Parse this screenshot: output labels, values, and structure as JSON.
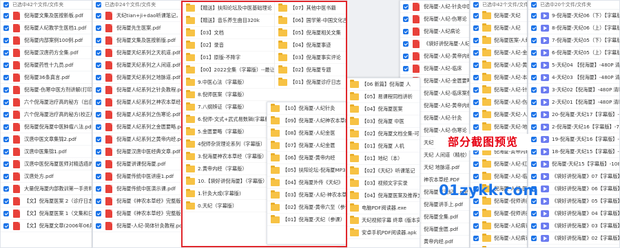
{
  "panel_a": {
    "header": "已选中42个文件/文件夹",
    "items": [
      "倪海厦文集及医按新板.pdf",
      "倪海厦人纪教学生医档1.pdf",
      "倪海厦内部案例100例.pdf",
      "倪海厦汉唐药方全集.pdf",
      "倪海厦药性十九员.pdf",
      "倪海厦36条真言.pdf",
      "倪海厦-伤寒中医方剂讲解(打印版).pdf",
      "六个倪海厦治疗高的秘方（出自：倪海厦",
      "六个倪海厦治疗高的秘方(校正版).pdf",
      "倪海厦倪海厦中医肿瘤八法.pdf",
      "汉唐中医文章集锦2.pdf",
      "汉唐中医集锦1.pdf",
      "汉唐中医倪海厦医师对精选癌的分析及其",
      "汉唐处方.pdf",
      "大量倪海厦内部教训第一手资料有用药方",
      "【文】倪海厦医案 2（诊疗日志）日志",
      "【文】倪海厦医案 1（文集和日志）日",
      "【文】倪海厦文章(2006年06月01日)"
    ]
  },
  "panel_b": {
    "header": "已选中24个文件/文件夹",
    "items": [
      "天纪tian+ji+dao听课笔记，精彩绝伦.pdf",
      "倪海厦先生医案.pdf",
      "倪海厦文集及医按新版.pdf",
      "倪海厦天纪系列之天机道.pdf",
      "倪海厦天纪系列之人间道.pdf",
      "倪海厦天纪系列之地脉道.pdf",
      "倪海厦人纪系列之针灸教程.pdf",
      "倪海厦人纪系列之神农本草经.pdf",
      "倪海厦人纪系列之伤寒论.pdf",
      "倪海厦人纪系列之金匮要略.pdf",
      "倪海厦人纪系列之黄帝内经.pdf",
      "倪海厦汉唐中医经典文章.pdf",
      "倪海厦讲课倪海厦.pdf",
      "倪海厦传统中医讲座1.pdf",
      "倪海厦传统中医演示课.pdf",
      "倪海厦《神农本草经》完整版",
      "倪海厦《神农本草经》完整版----可直接打印",
      "倪海厦-人纪-简体针灸教程.pdf"
    ]
  },
  "main_panel": {
    "left_items": [
      "【赠送】扶阳论坛及中医基础理论",
      "【赠送】音乐养生曲目320k",
      "【03】文档",
      "【02】录音",
      "【01】原版-不降字",
      "【00】2022全集（字幕版）--最让个就够了",
      "9.中医心法（字幕版）",
      "8.倪师医案（字幕版）",
      "7.八纲辨证（字幕版）",
      "6.倪师-文式+武式易数辑(字幕版)",
      "5.金匮要略（字幕版）",
      "4倪师杂货理论系列（字幕版）",
      "3.倪海厦神农本草经（字幕版）",
      "2.黄帝内经（字幕版）",
      "10.【袋好讲倪海厦】（字幕版）",
      "1.针灸大成(字幕版)",
      "0.天纪（字幕版）"
    ],
    "right_items": [
      "【07】其他中医书籍",
      "【06】国学第-中国文化古典国力红楼读书，心，xing",
      "【05】倪海厦相关文集",
      "【04】倪海厦事迹",
      "【03】倪海厦事实评论",
      "【02】倪海厦专题",
      "【01】倪海厦诊疗日志"
    ],
    "sub_items": [
      "【10】倪海厦-人纪针灸",
      "【09】倪海厦-人纪神农本草经",
      "【08】倪海厦-人纪金医",
      "【07】倪海厦-人纪金匮",
      "【06】倪海厦-黄帝内经",
      "【05】扶阳论坛-倪海厦MP3",
      "【04】倪海厦外传《天纪》",
      "【03】倪海厦-人纪-神农本草经",
      "【02】倪海厦-黄帝六至（参课）",
      "【01】倪海厦-天纪（参课）"
    ]
  },
  "panel_d": {
    "items": [
      "【06 新篇】倪海厦 人",
      "【05】易课程同档讲析",
      "【04】倪海厦医案",
      "【03】倪海厦 中医",
      "【02】倪海厦文档全集-可打印（24",
      "【01】倪海厦 人机",
      "【01】地纪（本）",
      "【02】《天纪》听课笔记",
      "【03】视频文字实录",
      "【04】倪海厦医案及推荐文档（17",
      "电脑PDF阅读器.exe",
      "天纪视频字幕 终章 (版本实际 数据",
      "安卓手机PDF阅读器.apk"
    ]
  },
  "panel_e": {
    "items": [
      "倪海厦-人纪-针灸中医",
      "倪海厦-人纪-伤寒论",
      "倪海厦-人纪病论",
      "《袋好讲倪海厦-人纪》",
      "倪海厦-人纪-黄帝内经",
      "倪海厦-人纪-临床",
      "倪海厦-人纪-金匮要略",
      "倪海厦-人纪-临床案例",
      "倪海厦-人纪-黄帝内经",
      "倪海厦-人纪-针灸",
      "倪海厦-人纪-伤寒论",
      "天纪 天机道（精校）",
      "天纪 人间道（精校）",
      "天纪 地脉道.pdf",
      "神农本草经.PDF",
      "倪海厦《天纪》.pdf",
      "倪海厦讲手上.pdf",
      "倪海厦全集.pdf",
      "倪海厦金匮.pdf",
      "黄帝内经.pdf"
    ]
  },
  "panel_f": {
    "header": "已选中42个文件/文件夹",
    "items": [
      "倪海厦-天纪",
      "倪海厦-人纪",
      "倪海厦医案-人纪",
      "倪海厦-人纪-金匮",
      "倪海厦-人纪-黄帝",
      "倪海厦-人纪-本草",
      "倪海厦-人纪-针灸",
      "倪海厦-人纪-伤寒",
      "倪海厦-天纪-人间",
      "倪海厦-天纪-地脉",
      "倪海厦-天纪-天机",
      "倪海厦-黄帝内经",
      "倪海厦-人纪-红楼",
      "倪海厦-人纪-临床",
      "倪海厦-人纪-医案",
      "倪海厦-倪师讲座",
      "倪海厦-倪师讲座",
      "倪海厦-人纪病论",
      "倪海厦-人纪病论",
      "倪海厦-人纪病论"
    ]
  },
  "panel_g": {
    "header": "已选中20个文件/文件夹",
    "items": [
      "9-倪海厦-天纪06（下）【字幕版】-720P",
      "8-倪海厦-天纪06（上）【字幕版】-720P",
      "7-倪海厦-天纪05（下）【字幕版】-720P",
      "6-倪海厦-天纪05（上）【字幕版】-720P",
      "5-天纪04 【倪海厦】-480P 清晰-AVC.mp4",
      "4-天纪03 【倪海厦】-480P 清晰-AVC.mp4",
      "3-天纪02【倪海厦】-480P 清晰-AVC.mp4",
      "2-天纪01【倪海厦】-480P 清晰-AVC.mp4",
      "20-倪海厦-天纪17【字幕版】-720P",
      "2-倪海厦-天纪16【字幕版】-720P",
      "19-倪海厦-天纪16【字幕版】-720P",
      "18-倪海厦-天纪15【字幕版】-720P",
      "倪海厦-天纪15【字幕版】-1080P",
      "《袋好讲倪海厦》07【字幕版】_玩道.flv",
      "《袋好讲倪海厦》06【字幕版】_玩道.flv",
      "《袋好讲倪海厦》05【字幕版】_玩道.flv",
      "《袋好讲倪海厦》04【字幕版】_玩道.flv",
      "《袋好讲倪海厦》03【字幕版】_玩道.flv",
      "《袋好讲倪海厦》02【字幕版】_玩道.flv"
    ]
  },
  "overlay": {
    "banner": "部分截图预览",
    "site": "01zykk.com"
  }
}
